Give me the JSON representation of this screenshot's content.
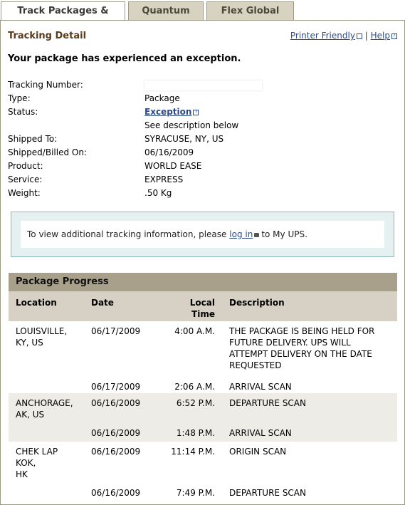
{
  "tabs": [
    {
      "label": "Track Packages & Freight"
    },
    {
      "label": "Quantum View"
    },
    {
      "label": "Flex Global View"
    }
  ],
  "header": {
    "title": "Tracking Detail",
    "printer_friendly": "Printer Friendly",
    "separator": "|",
    "help": "Help"
  },
  "message": "Your package has experienced an exception.",
  "details": {
    "tracking_number_label": "Tracking Number:",
    "type_label": "Type:",
    "type_value": "Package",
    "status_label": "Status:",
    "status_value": "Exception",
    "status_note": "See description below",
    "shipped_to_label": "Shipped To:",
    "shipped_to_value": "SYRACUSE, NY, US",
    "shipped_on_label": "Shipped/Billed On:",
    "shipped_on_value": "06/16/2009",
    "product_label": "Product:",
    "product_value": "WORLD EASE",
    "service_label": "Service:",
    "service_value": "EXPRESS",
    "weight_label": "Weight:",
    "weight_value": ".50 Kg"
  },
  "notice": {
    "prefix": "To view additional tracking information, please",
    "link": "log in",
    "suffix": "to My UPS."
  },
  "progress": {
    "title": "Package Progress",
    "columns": {
      "location": "Location",
      "date": "Date",
      "time_line1": "Local",
      "time_line2": "Time",
      "description": "Description"
    },
    "rows": [
      {
        "location": "LOUISVILLE,\nKY,  US",
        "date": "06/17/2009",
        "time": "4:00 A.M.",
        "description": "THE PACKAGE IS BEING HELD FOR FUTURE DELIVERY. UPS WILL ATTEMPT DELIVERY ON THE DATE REQUESTED"
      },
      {
        "location": "",
        "date": "06/17/2009",
        "time": "2:06 A.M.",
        "description": "ARRIVAL SCAN"
      },
      {
        "location": "ANCHORAGE,\nAK,  US",
        "date": "06/16/2009",
        "time": "6:52 P.M.",
        "description": "DEPARTURE SCAN"
      },
      {
        "location": "",
        "date": "06/16/2009",
        "time": "1:48 P.M.",
        "description": "ARRIVAL SCAN"
      },
      {
        "location": "CHEK LAP\nKOK,\nHK",
        "date": "06/16/2009",
        "time": "11:14 P.M.",
        "description": "ORIGIN SCAN"
      },
      {
        "location": "",
        "date": "06/16/2009",
        "time": "7:49 P.M.",
        "description": "DEPARTURE SCAN"
      }
    ]
  }
}
